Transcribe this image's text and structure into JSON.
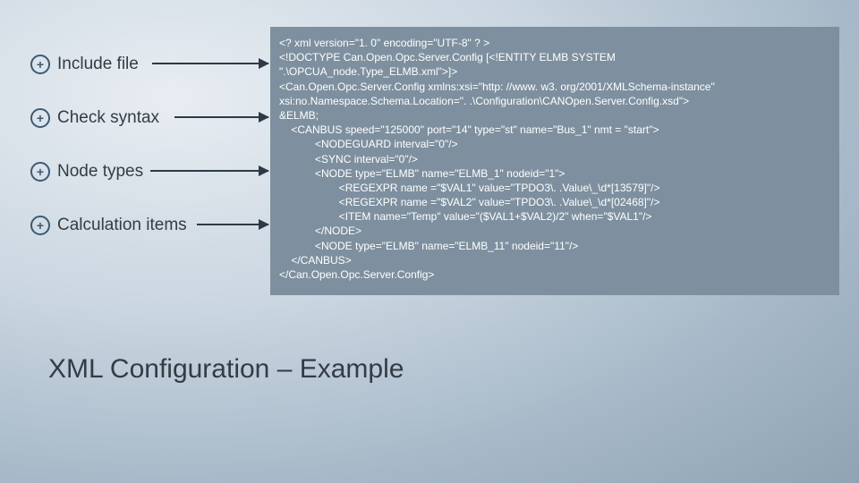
{
  "bullets": {
    "b1": "Include file",
    "b2": "Check syntax",
    "b3": "Node types",
    "b4": "Calculation items"
  },
  "code": {
    "l01": "<? xml version=\"1. 0\" encoding=\"UTF-8\" ? >",
    "l02": "<!DOCTYPE Can.Open.Opc.Server.Config [<!ENTITY ELMB SYSTEM",
    "l03": "\".\\OPCUA_node.Type_ELMB.xml\">]>",
    "l04": "<Can.Open.Opc.Server.Config xmlns:xsi=\"http: //www. w3. org/2001/XMLSchema-instance\"",
    "l05": "xsi:no.Namespace.Schema.Location=\". .\\Configuration\\CANOpen.Server.Config.xsd\">",
    "l06": "&ELMB;",
    "l07": "    <CANBUS speed=\"125000\" port=\"14\" type=\"st\" name=\"Bus_1\" nmt = \"start\">",
    "l08": "            <NODEGUARD interval=\"0\"/>",
    "l09": "            <SYNC interval=\"0\"/>",
    "l10": "            <NODE type=\"ELMB\" name=\"ELMB_1\" nodeid=\"1\">",
    "l11": "                    <REGEXPR name =\"$VAL1\" value=\"TPDO3\\. .Value\\_\\d*[13579]\"/>",
    "l12": "                    <REGEXPR name =\"$VAL2\" value=\"TPDO3\\. .Value\\_\\d*[02468]\"/>",
    "l13": "                    <ITEM name=\"Temp\" value=\"($VAL1+$VAL2)/2\" when=\"$VAL1\"/>",
    "l14": "            </NODE>",
    "l15": "            <NODE type=\"ELMB\" name=\"ELMB_11\" nodeid=\"11\"/>",
    "l16": "    </CANBUS>",
    "l17": "</Can.Open.Opc.Server.Config>"
  },
  "title": "XML Configuration – Example"
}
